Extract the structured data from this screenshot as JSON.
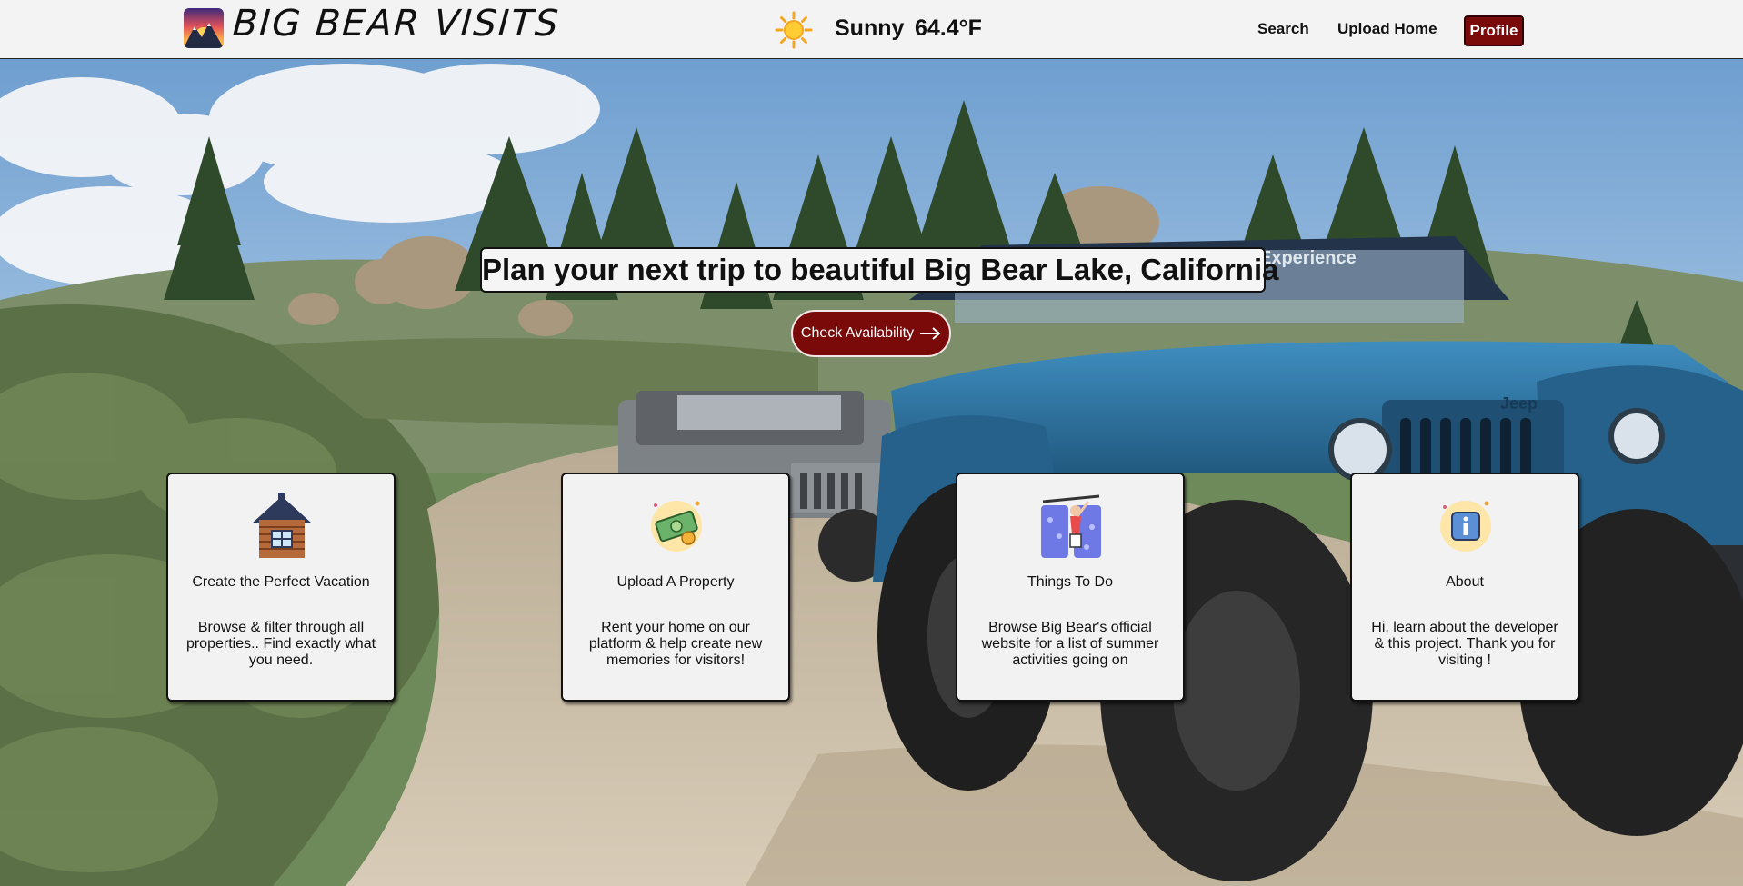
{
  "header": {
    "brand": "BIG BEAR VISITS",
    "weather": {
      "condition": "Sunny",
      "temperature": "64.4°F",
      "icon": "sun-icon"
    },
    "nav": {
      "search": "Search",
      "upload_home": "Upload Home",
      "profile": "Profile"
    }
  },
  "hero": {
    "headline": "Plan your next trip to beautiful Big Bear Lake, California",
    "cta_label": "Check Availability",
    "jeep_windshield_text": "Experience",
    "jeep_grill_text": "Jeep"
  },
  "cards": [
    {
      "icon": "cabin-icon",
      "title": "Create the Perfect Vacation",
      "description": "Browse & filter through all properties.. Find exactly what you need."
    },
    {
      "icon": "money-icon",
      "title": "Upload A Property",
      "description": "Rent your home on our platform & help create new memories for visitors!"
    },
    {
      "icon": "climber-icon",
      "title": "Things To Do",
      "description": "Browse Big Bear's official website for a list of summer activities going on"
    },
    {
      "icon": "info-icon",
      "title": "About",
      "description": "Hi, learn about the developer & this project. Thank you for visiting !"
    }
  ],
  "colors": {
    "accent": "#7a0a0a",
    "header_bg": "#f3f3f3",
    "card_bg": "#f2f2f2",
    "jeep_blue": "#2f77a6"
  }
}
